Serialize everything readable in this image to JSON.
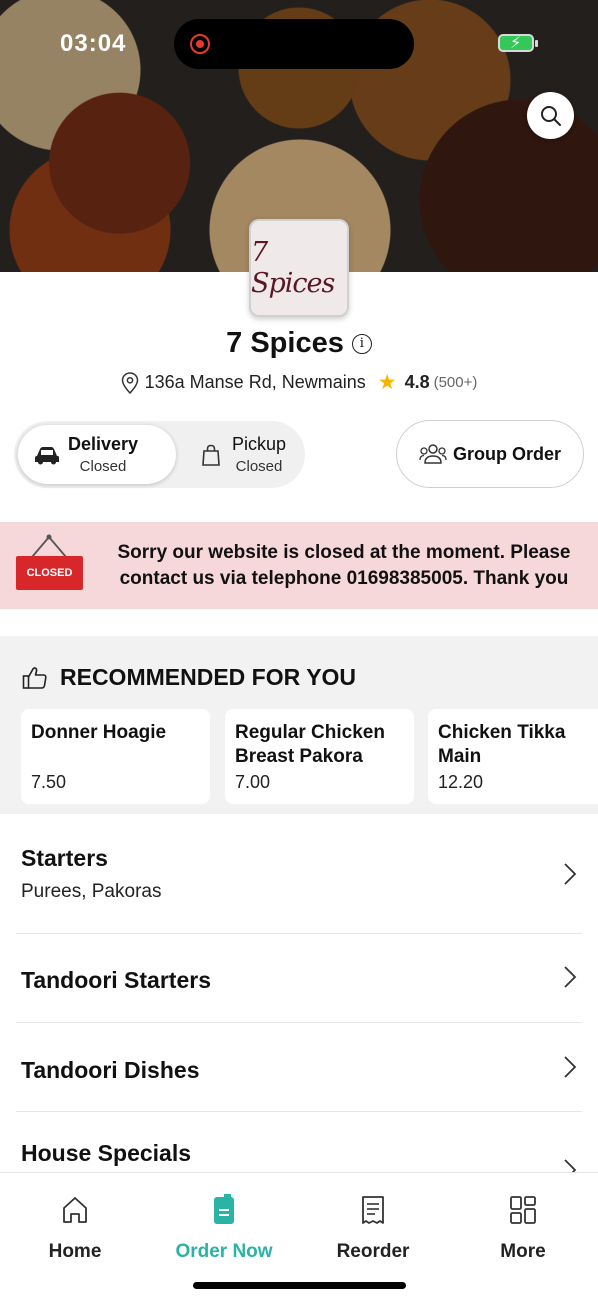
{
  "status_bar": {
    "time": "03:04"
  },
  "restaurant": {
    "logo_text": "7 Spices",
    "name": "7 Spices",
    "address": "136a Manse Rd, Newmains",
    "rating": "4.8",
    "rating_count": "(500+)"
  },
  "modes": {
    "delivery": {
      "label": "Delivery",
      "status": "Closed"
    },
    "pickup": {
      "label": "Pickup",
      "status": "Closed"
    }
  },
  "group_order_label": "Group Order",
  "banner": {
    "sign_text": "CLOSED",
    "message": "Sorry our website is closed at the moment. Please contact us via telephone 01698385005. Thank you"
  },
  "recommended": {
    "title": "RECOMMENDED FOR YOU",
    "items": [
      {
        "name": "Donner Hoagie",
        "price": "7.50"
      },
      {
        "name": "Regular Chicken Breast Pakora",
        "price": "7.00"
      },
      {
        "name": "Chicken Tikka Main",
        "price": "12.20"
      }
    ]
  },
  "categories": [
    {
      "title": "Starters",
      "subtitle": "Purees, Pakoras"
    },
    {
      "title": "Tandoori Starters"
    },
    {
      "title": "Tandoori Dishes"
    },
    {
      "title": "House Specials"
    }
  ],
  "nav": {
    "home": "Home",
    "order_now": "Order Now",
    "reorder": "Reorder",
    "more": "More"
  },
  "colors": {
    "accent": "#2bb3a5",
    "closed_banner": "#f7d8da",
    "closed_sign": "#d8272b",
    "star": "#f7b500"
  }
}
